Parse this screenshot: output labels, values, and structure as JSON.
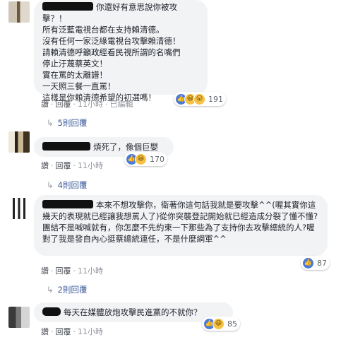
{
  "comments": [
    {
      "text": "你還好有意思說你被攻擊？！\n所有泛藍電視台都在支持賴清德。\n沒有任何一家泛綠電視台攻擊賴清德！\n請賴清德呼籲政經看民視所謂的名嘴們\n停止汙蔑蔡英文！\n實在罵的太離譜！\n一天照三餐一直罵！\n這樣是你賴清德希望的初選嗎！",
      "reactions": [
        "like-icon",
        "haha-icon",
        "wow-icon"
      ],
      "count": "191",
      "actions": {
        "like": "讚",
        "reply": "回覆",
        "time": "11小時",
        "edited": "已編輯"
      },
      "replies": "5則回覆"
    },
    {
      "text": "煩死了，像個巨嬰",
      "reactions": [
        "like-icon",
        "haha-icon"
      ],
      "count": "170",
      "actions": {
        "like": "讚",
        "reply": "回覆",
        "time": "11小時"
      },
      "replies": "4則回覆"
    },
    {
      "text": "本來不想攻擊你，衛著你這句話我就是要攻擊^^(喔其實你這幾天的表現就已經讓我想罵人了)從你突襲登記開始就已經造成分裂了懂不懂?團結不是喊喊就有，你怎麼不先約束一下那些為了支持你去攻擊總統的人?喔對了我是發自內心挺蔡總統連任，不是什麼網軍^^",
      "reactions": [
        "like-icon"
      ],
      "count": "87",
      "actions": {
        "like": "讚",
        "reply": "回覆",
        "time": "11小時"
      },
      "replies": "2則回覆"
    },
    {
      "text": "每天在媒體放炮攻擊民進黨的不就你？",
      "reactions": [
        "like-icon",
        "haha-icon"
      ],
      "count": "85",
      "actions": {
        "like": "讚",
        "reply": "回覆",
        "time": "11小時"
      }
    }
  ]
}
